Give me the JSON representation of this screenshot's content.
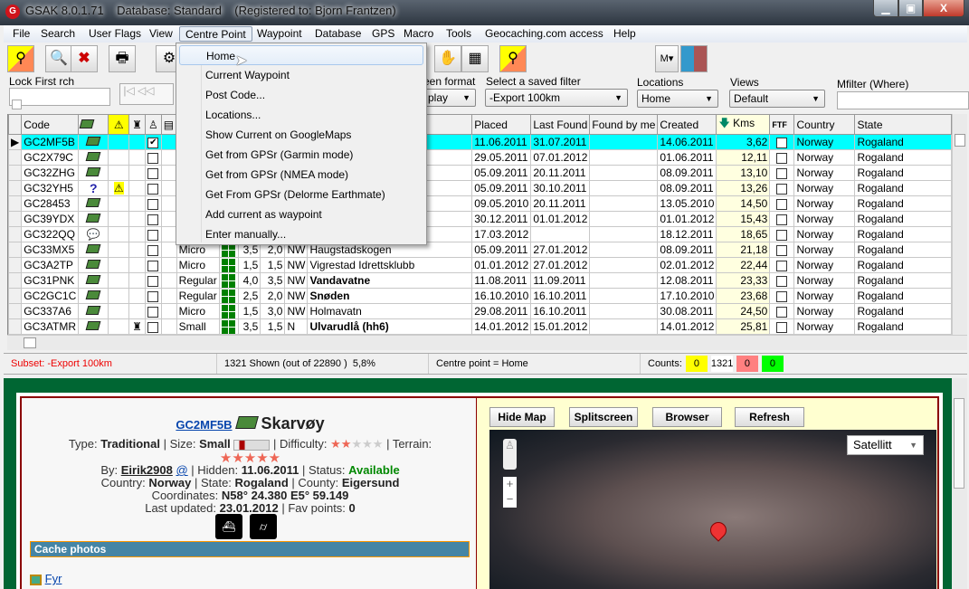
{
  "window": {
    "title": "GSAK 8.0.1.71    Database: Standard    (Registered to: Bjorn Frantzen)",
    "minimize": "▁",
    "maximize": "▣",
    "close": "X"
  },
  "menu": [
    "File",
    "Search",
    "User Flags",
    "View",
    "Centre Point",
    "Waypoint",
    "Database",
    "GPS",
    "Macro",
    "Tools",
    "Geocaching.com access",
    "Help"
  ],
  "centre_point_menu": [
    "Home",
    "Current Waypoint",
    "Post Code...",
    "Locations...",
    "Show Current on GoogleMaps",
    "Get from GPSr (Garmin mode)",
    "Get from GPSr (NMEA mode)",
    "Get From GPSr (Delorme Earthmate)",
    "Add current as waypoint",
    "Enter manually..."
  ],
  "toolbar": {
    "m_button": "M"
  },
  "filters": {
    "lock_label": "Lock First rch",
    "screen_format_label": "een format",
    "screen_format_value": "play",
    "saved_filter_label": "Select a saved filter",
    "saved_filter_value": "-Export 100km",
    "locations_label": "Locations",
    "locations_value": "Home",
    "views_label": "Views",
    "views_value": "Default",
    "mfilter_label": "Mfilter (Where)",
    "mfilter_value": ""
  },
  "grid": {
    "headers": {
      "code": "Code",
      "placed": "Placed",
      "last_found": "Last Found",
      "found_by_me": "Found by me",
      "created": "Created",
      "kms": "Kms",
      "ftf": "FTF",
      "country": "Country",
      "state": "State"
    },
    "rows": [
      {
        "code": "GC2MF5B",
        "type": "traditional",
        "warn": false,
        "bug": false,
        "found": true,
        "size": "",
        "d": "",
        "t": "",
        "dir": "",
        "name": "",
        "placed": "11.06.2011",
        "last_found": "31.07.2011",
        "created": "14.06.2011",
        "kms": "3,62",
        "country": "Norway",
        "state": "Rogaland",
        "selected": true
      },
      {
        "code": "GC2X79C",
        "type": "traditional",
        "size": "",
        "d": "",
        "t": "",
        "dir": "",
        "name": "",
        "placed": "29.05.2011",
        "last_found": "07.01.2012",
        "created": "01.06.2011",
        "kms": "12,11",
        "country": "Norway",
        "state": "Rogaland"
      },
      {
        "code": "GC32ZHG",
        "type": "traditional",
        "size": "",
        "d": "",
        "t": "",
        "dir": "",
        "name": "",
        "placed": "05.09.2011",
        "last_found": "20.11.2011",
        "created": "08.09.2011",
        "kms": "13,10",
        "country": "Norway",
        "state": "Rogaland"
      },
      {
        "code": "GC32YH5",
        "type": "mystery",
        "warn": true,
        "size": "",
        "d": "",
        "t": "",
        "dir": "",
        "name": "",
        "placed": "05.09.2011",
        "last_found": "30.10.2011",
        "created": "08.09.2011",
        "kms": "13,26",
        "country": "Norway",
        "state": "Rogaland"
      },
      {
        "code": "GC28453",
        "type": "traditional",
        "size": "",
        "d": "",
        "t": "",
        "dir": "",
        "name": "",
        "placed": "09.05.2010",
        "last_found": "20.11.2011",
        "created": "13.05.2010",
        "kms": "14,50",
        "country": "Norway",
        "state": "Rogaland"
      },
      {
        "code": "GC39YDX",
        "type": "traditional",
        "size": "",
        "d": "",
        "t": "",
        "dir": "",
        "name": "",
        "placed": "30.12.2011",
        "last_found": "01.01.2012",
        "created": "01.01.2012",
        "kms": "15,43",
        "country": "Norway",
        "state": "Rogaland"
      },
      {
        "code": "GC322QQ",
        "type": "event",
        "size": "",
        "d": "",
        "t": "",
        "dir": "",
        "name": "",
        "placed": "17.03.2012",
        "last_found": "",
        "created": "18.12.2011",
        "kms": "18,65",
        "country": "Norway",
        "state": "Rogaland"
      },
      {
        "code": "GC33MX5",
        "type": "traditional",
        "size": "Micro",
        "d": "3,5",
        "t": "2,0",
        "dir": "NW",
        "name": "Haugstadskogen",
        "placed": "05.09.2011",
        "last_found": "27.01.2012",
        "created": "08.09.2011",
        "kms": "21,18",
        "country": "Norway",
        "state": "Rogaland"
      },
      {
        "code": "GC3A2TP",
        "type": "traditional",
        "size": "Micro",
        "d": "1,5",
        "t": "1,5",
        "dir": "NW",
        "name": "Vigrestad Idrettsklubb",
        "placed": "01.01.2012",
        "last_found": "27.01.2012",
        "created": "02.01.2012",
        "kms": "22,44",
        "country": "Norway",
        "state": "Rogaland"
      },
      {
        "code": "GC31PNK",
        "type": "traditional",
        "size": "Regular",
        "d": "4,0",
        "t": "3,5",
        "dir": "NW",
        "name": "Vandavatne",
        "bold": true,
        "placed": "11.08.2011",
        "last_found": "11.09.2011",
        "created": "12.08.2011",
        "kms": "23,33",
        "country": "Norway",
        "state": "Rogaland"
      },
      {
        "code": "GC2GC1C",
        "type": "traditional",
        "size": "Regular",
        "d": "2,5",
        "t": "2,0",
        "dir": "NW",
        "name": "Snøden",
        "bold": true,
        "placed": "16.10.2010",
        "last_found": "16.10.2011",
        "created": "17.10.2010",
        "kms": "23,68",
        "country": "Norway",
        "state": "Rogaland"
      },
      {
        "code": "GC337A6",
        "type": "traditional",
        "size": "Micro",
        "d": "1,5",
        "t": "3,0",
        "dir": "NW",
        "name": "Holmavatn",
        "placed": "29.08.2011",
        "last_found": "16.10.2011",
        "created": "30.08.2011",
        "kms": "24,50",
        "country": "Norway",
        "state": "Rogaland"
      },
      {
        "code": "GC3ATMR",
        "type": "traditional",
        "bug": true,
        "size": "Small",
        "d": "3,5",
        "t": "1,5",
        "dir": "N",
        "name": "Ulvarudlå (hh6)",
        "bold": true,
        "placed": "14.01.2012",
        "last_found": "15.01.2012",
        "created": "14.01.2012",
        "kms": "25,81",
        "country": "Norway",
        "state": "Rogaland"
      }
    ]
  },
  "status": {
    "subset": "Subset: -Export 100km",
    "shown": "1321 Shown (out of 22890 )  5,8%",
    "centre": "Centre point = Home",
    "counts_label": "Counts:",
    "counts": [
      "0",
      "1321",
      "0",
      "0"
    ],
    "count_colors": [
      "#ffff00",
      "#ffffff",
      "#ff8080",
      "#00ff00"
    ]
  },
  "detail": {
    "code": "GC2MF5B",
    "name": "Skarvøy",
    "type_label": "Type:",
    "type": "Traditional",
    "size_label": "| Size:",
    "size": "Small",
    "difficulty_label": "| Difficulty:",
    "difficulty": 2,
    "terrain_label": "| Terrain:",
    "terrain": 5,
    "by_label": "By:",
    "owner": "Eirik2908",
    "at": "@",
    "hidden_label": "| Hidden:",
    "hidden": "11.06.2011",
    "status_label": "| Status:",
    "status": "Available",
    "country_label": "Country:",
    "country": "Norway",
    "state_label": "| State:",
    "state": "Rogaland",
    "county_label": "| County:",
    "county": "Eigersund",
    "coords_label": "Coordinates:",
    "coords": "N58° 24.380 E5° 59.149",
    "updated_label": "Last updated:",
    "updated": "23.01.2012",
    "fav_label": "| Fav points:",
    "fav": "0",
    "photos_header": "Cache photos",
    "photo": "Fyr"
  },
  "map": {
    "hide": "Hide Map",
    "split": "Splitscreen",
    "browser": "Browser",
    "refresh": "Refresh",
    "type": "Satellitt",
    "zoom_in": "+",
    "zoom_out": "−"
  }
}
